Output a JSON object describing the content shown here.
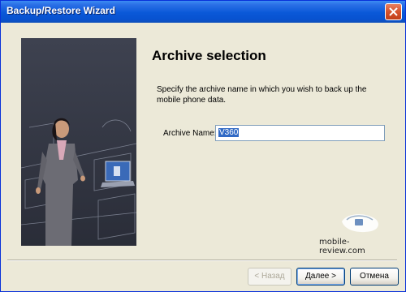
{
  "window": {
    "title": "Backup/Restore Wizard"
  },
  "page": {
    "heading": "Archive selection",
    "description": "Specify the archive name in which you wish to back up the mobile phone data.",
    "archive_label": "Archive Name:",
    "archive_value": "V360"
  },
  "watermark": {
    "text": "mobile-review.com"
  },
  "buttons": {
    "back": "< Назад",
    "next": "Далее >",
    "cancel": "Отмена"
  },
  "icons": {
    "close": "close-icon",
    "side": "wizard-side-illustration",
    "logo": "mobile-review-logo-icon"
  },
  "colors": {
    "titlebar": "#0a58d8",
    "dialog_bg": "#ece9d8",
    "selection": "#316ac5"
  }
}
